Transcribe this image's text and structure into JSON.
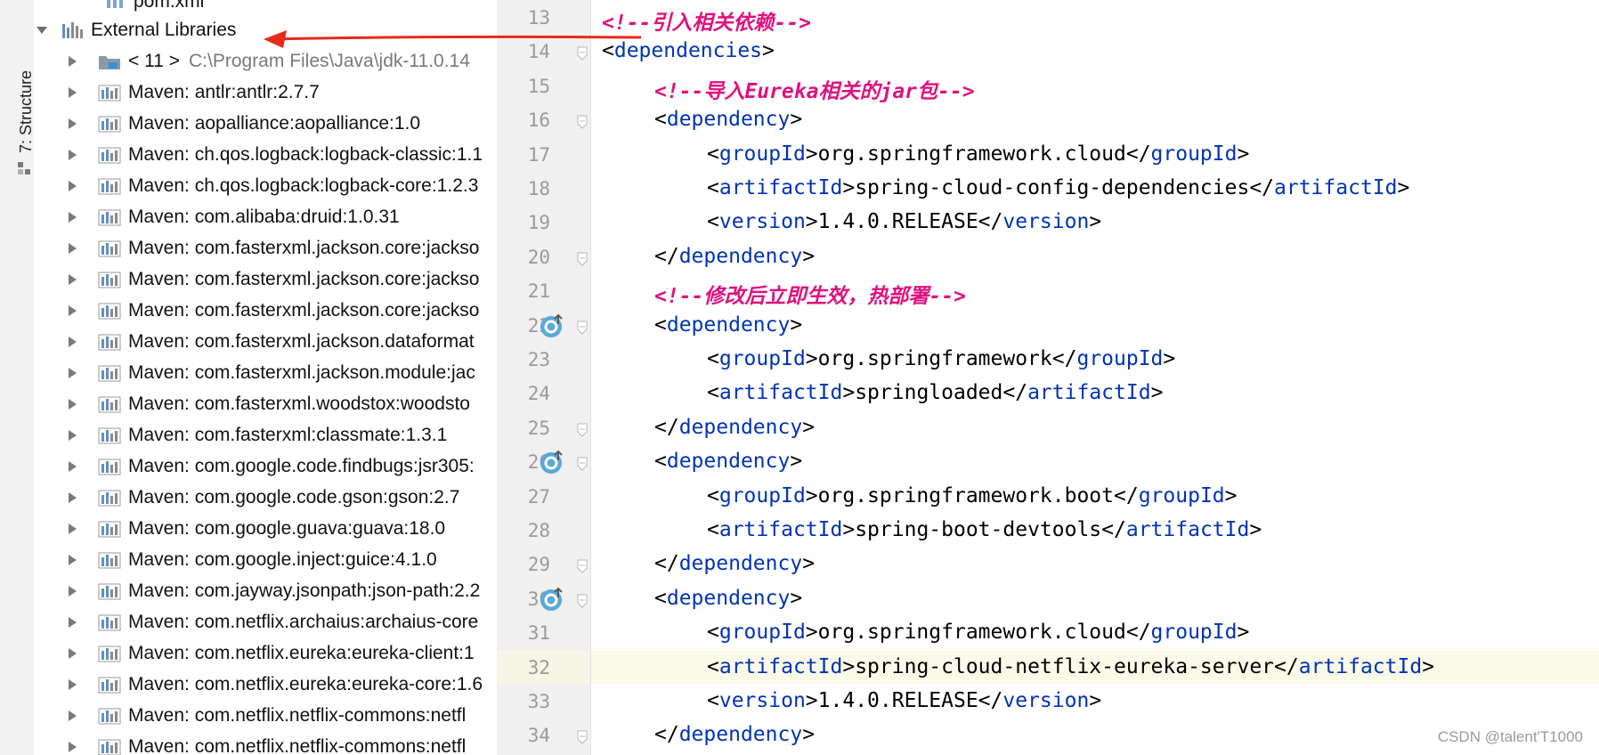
{
  "sidebar": {
    "structure_tab_label": "7: Structure"
  },
  "tree": {
    "partial_top_item": "pom.xml",
    "root_label": "External Libraries",
    "items": [
      {
        "label": "< 11 >",
        "sublabel": "C:\\Program Files\\Java\\jdk-11.0.14",
        "icon": "jdk-folder-icon"
      },
      {
        "label": "Maven: antlr:antlr:2.7.7",
        "sublabel": "",
        "icon": "library-icon"
      },
      {
        "label": "Maven: aopalliance:aopalliance:1.0",
        "sublabel": "",
        "icon": "library-icon"
      },
      {
        "label": "Maven: ch.qos.logback:logback-classic:1.1",
        "sublabel": "",
        "icon": "library-icon"
      },
      {
        "label": "Maven: ch.qos.logback:logback-core:1.2.3",
        "sublabel": "",
        "icon": "library-icon"
      },
      {
        "label": "Maven: com.alibaba:druid:1.0.31",
        "sublabel": "",
        "icon": "library-icon"
      },
      {
        "label": "Maven: com.fasterxml.jackson.core:jackso",
        "sublabel": "",
        "icon": "library-icon"
      },
      {
        "label": "Maven: com.fasterxml.jackson.core:jackso",
        "sublabel": "",
        "icon": "library-icon"
      },
      {
        "label": "Maven: com.fasterxml.jackson.core:jackso",
        "sublabel": "",
        "icon": "library-icon"
      },
      {
        "label": "Maven: com.fasterxml.jackson.dataformat",
        "sublabel": "",
        "icon": "library-icon"
      },
      {
        "label": "Maven: com.fasterxml.jackson.module:jac",
        "sublabel": "",
        "icon": "library-icon"
      },
      {
        "label": "Maven: com.fasterxml.woodstox:woodsto",
        "sublabel": "",
        "icon": "library-icon"
      },
      {
        "label": "Maven: com.fasterxml:classmate:1.3.1",
        "sublabel": "",
        "icon": "library-icon"
      },
      {
        "label": "Maven: com.google.code.findbugs:jsr305:",
        "sublabel": "",
        "icon": "library-icon"
      },
      {
        "label": "Maven: com.google.code.gson:gson:2.7",
        "sublabel": "",
        "icon": "library-icon"
      },
      {
        "label": "Maven: com.google.guava:guava:18.0",
        "sublabel": "",
        "icon": "library-icon"
      },
      {
        "label": "Maven: com.google.inject:guice:4.1.0",
        "sublabel": "",
        "icon": "library-icon"
      },
      {
        "label": "Maven: com.jayway.jsonpath:json-path:2.2",
        "sublabel": "",
        "icon": "library-icon"
      },
      {
        "label": "Maven: com.netflix.archaius:archaius-core",
        "sublabel": "",
        "icon": "library-icon"
      },
      {
        "label": "Maven: com.netflix.eureka:eureka-client:1",
        "sublabel": "",
        "icon": "library-icon"
      },
      {
        "label": "Maven: com.netflix.eureka:eureka-core:1.6",
        "sublabel": "",
        "icon": "library-icon"
      },
      {
        "label": "Maven: com.netflix.netflix-commons:netfl",
        "sublabel": "",
        "icon": "library-icon"
      },
      {
        "label": "Maven: com.netflix.netflix-commons:netfl",
        "sublabel": "",
        "icon": "library-icon"
      }
    ]
  },
  "editor": {
    "line_numbers": [
      "13",
      "14",
      "15",
      "16",
      "17",
      "18",
      "19",
      "20",
      "21",
      "22",
      "23",
      "24",
      "25",
      "26",
      "27",
      "28",
      "29",
      "30",
      "31",
      "32",
      "33",
      "34"
    ],
    "current_line": "32",
    "lines": [
      {
        "indent": 0,
        "kind": "comment",
        "text": "<!--引入相关依赖-->"
      },
      {
        "indent": 0,
        "kind": "open",
        "tag": "dependencies"
      },
      {
        "indent": 1,
        "kind": "comment",
        "text": "<!--导入Eureka相关的jar包-->"
      },
      {
        "indent": 1,
        "kind": "open",
        "tag": "dependency"
      },
      {
        "indent": 2,
        "kind": "elem",
        "tag": "groupId",
        "value": "org.springframework.cloud"
      },
      {
        "indent": 2,
        "kind": "elem",
        "tag": "artifactId",
        "value": "spring-cloud-config-dependencies"
      },
      {
        "indent": 2,
        "kind": "elem",
        "tag": "version",
        "value": "1.4.0.RELEASE"
      },
      {
        "indent": 1,
        "kind": "close",
        "tag": "dependency"
      },
      {
        "indent": 1,
        "kind": "comment",
        "text": "<!--修改后立即生效，热部署-->"
      },
      {
        "indent": 1,
        "kind": "open",
        "tag": "dependency"
      },
      {
        "indent": 2,
        "kind": "elem",
        "tag": "groupId",
        "value": "org.springframework"
      },
      {
        "indent": 2,
        "kind": "elem",
        "tag": "artifactId",
        "value": "springloaded"
      },
      {
        "indent": 1,
        "kind": "close",
        "tag": "dependency"
      },
      {
        "indent": 1,
        "kind": "open",
        "tag": "dependency"
      },
      {
        "indent": 2,
        "kind": "elem",
        "tag": "groupId",
        "value": "org.springframework.boot"
      },
      {
        "indent": 2,
        "kind": "elem",
        "tag": "artifactId",
        "value": "spring-boot-devtools"
      },
      {
        "indent": 1,
        "kind": "close",
        "tag": "dependency"
      },
      {
        "indent": 1,
        "kind": "open",
        "tag": "dependency"
      },
      {
        "indent": 2,
        "kind": "elem",
        "tag": "groupId",
        "value": "org.springframework.cloud"
      },
      {
        "indent": 2,
        "kind": "elem",
        "tag": "artifactId",
        "value": "spring-cloud-netflix-eureka-server"
      },
      {
        "indent": 2,
        "kind": "elem",
        "tag": "version",
        "value": "1.4.0.RELEASE"
      },
      {
        "indent": 1,
        "kind": "close",
        "tag": "dependency"
      }
    ],
    "override_marker_lines": [
      "22",
      "26",
      "30"
    ],
    "fold_marker_lines": [
      "14",
      "16",
      "20",
      "22",
      "25",
      "26",
      "29",
      "30",
      "34"
    ]
  },
  "watermark": "CSDN @talent'T1000",
  "colors": {
    "tag": "#0033b3",
    "comment": "#e0117f",
    "annotation_arrow": "#e8291c",
    "current_line": "#fbf9e8"
  }
}
